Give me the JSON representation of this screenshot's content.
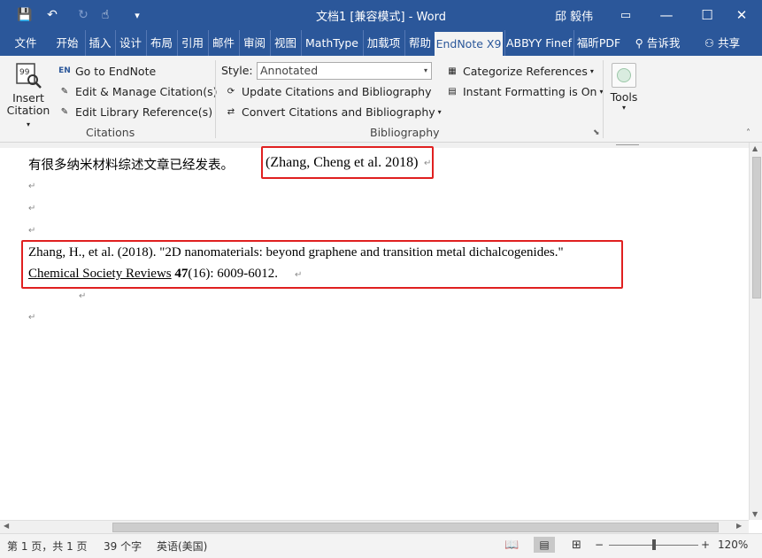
{
  "window": {
    "title": "文档1 [兼容模式] - Word",
    "user": "邱 毅伟",
    "controls": {
      "ribbon_opts": "▭",
      "minimize": "—",
      "maximize": "☐",
      "close": "✕"
    }
  },
  "quick_access": {
    "save": "💾",
    "undo": "↶",
    "redo": "↻",
    "touch": "☝",
    "customize": "▾"
  },
  "tabs": [
    "文件",
    "开始",
    "插入",
    "设计",
    "布局",
    "引用",
    "邮件",
    "审阅",
    "视图",
    "MathType",
    "加载项",
    "帮助",
    "EndNote X9",
    "ABBYY Finef",
    "福昕PDF"
  ],
  "tell_me": "告诉我",
  "share": "共享",
  "ribbon": {
    "insert_citation": {
      "line1": "Insert",
      "line2": "Citation"
    },
    "goto_endnote": "Go to EndNote",
    "edit_manage": "Edit & Manage Citation(s)",
    "edit_library": "Edit Library Reference(s)",
    "group_citations": "Citations",
    "style_label": "Style:",
    "style_value": "Annotated",
    "update_citations": "Update Citations and Bibliography",
    "convert_citations": "Convert Citations and Bibliography",
    "categorize": "Categorize References",
    "instant_formatting": "Instant Formatting is On",
    "group_bibliography": "Bibliography",
    "tools": "Tools"
  },
  "document": {
    "line1_text": "有很多纳米材料综述文章已经发表。",
    "citation": "(Zhang, Cheng et al. 2018)",
    "ref_line1": "Zhang, H., et al. (2018). \"2D nanomaterials: beyond graphene and transition metal dichalcogenides.\"",
    "ref_journal": "Chemical Society Reviews",
    "ref_volume": "47",
    "ref_rest": "(16): 6009-6012.",
    "para_mark": "↵"
  },
  "status": {
    "page": "第 1 页，共 1 页",
    "words": "39 个字",
    "language": "英语(美国)",
    "zoom": "120%",
    "zoom_minus": "−",
    "zoom_plus": "+"
  }
}
